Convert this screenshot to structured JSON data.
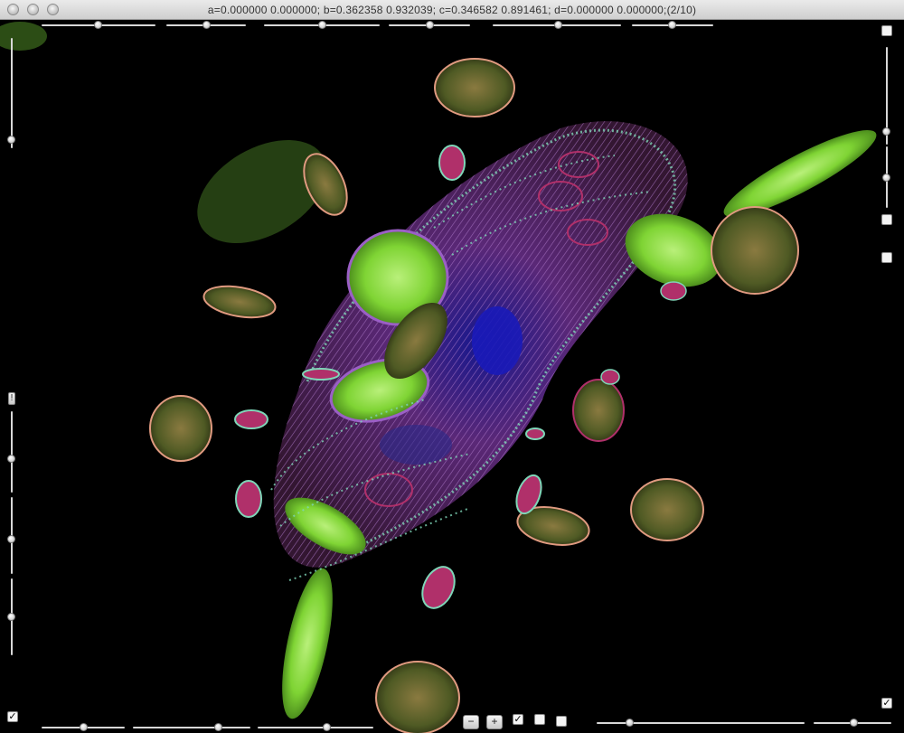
{
  "window": {
    "title": "a=0.000000 0.000000; b=0.362358 0.932039; c=0.346582 0.891461; d=0.000000 0.000000;(2/10)"
  },
  "controls": {
    "top_sliders": [
      0.49,
      0.6,
      0.5,
      0.5,
      0.55,
      0.5
    ],
    "left_sliders": [
      1.0,
      0.3,
      0.45,
      0.5
    ],
    "right_sliders": [
      0.05,
      0.45
    ],
    "bottom_sliders": [
      0.5,
      0.65,
      0.62,
      0.15,
      0.5
    ],
    "checkboxes": {
      "top_right": false,
      "right_middle_1": false,
      "right_middle_2": false,
      "bottom_left": true,
      "bottom_right": true,
      "bottom_toolbar_1": true,
      "bottom_toolbar_2": false,
      "bottom_toolbar_3": false
    },
    "checkmark_glyph": "✓",
    "minus_label": "−",
    "plus_label": "+",
    "marker_label": "!"
  },
  "visualization": {
    "colors": {
      "lime": "#8ee63c",
      "olive": "#5c6a2a",
      "magenta": "#b0306a",
      "teal": "#7fd6b8",
      "violet": "#9b5fc6",
      "blue": "#2020b0",
      "salmon": "#e09a80"
    }
  }
}
